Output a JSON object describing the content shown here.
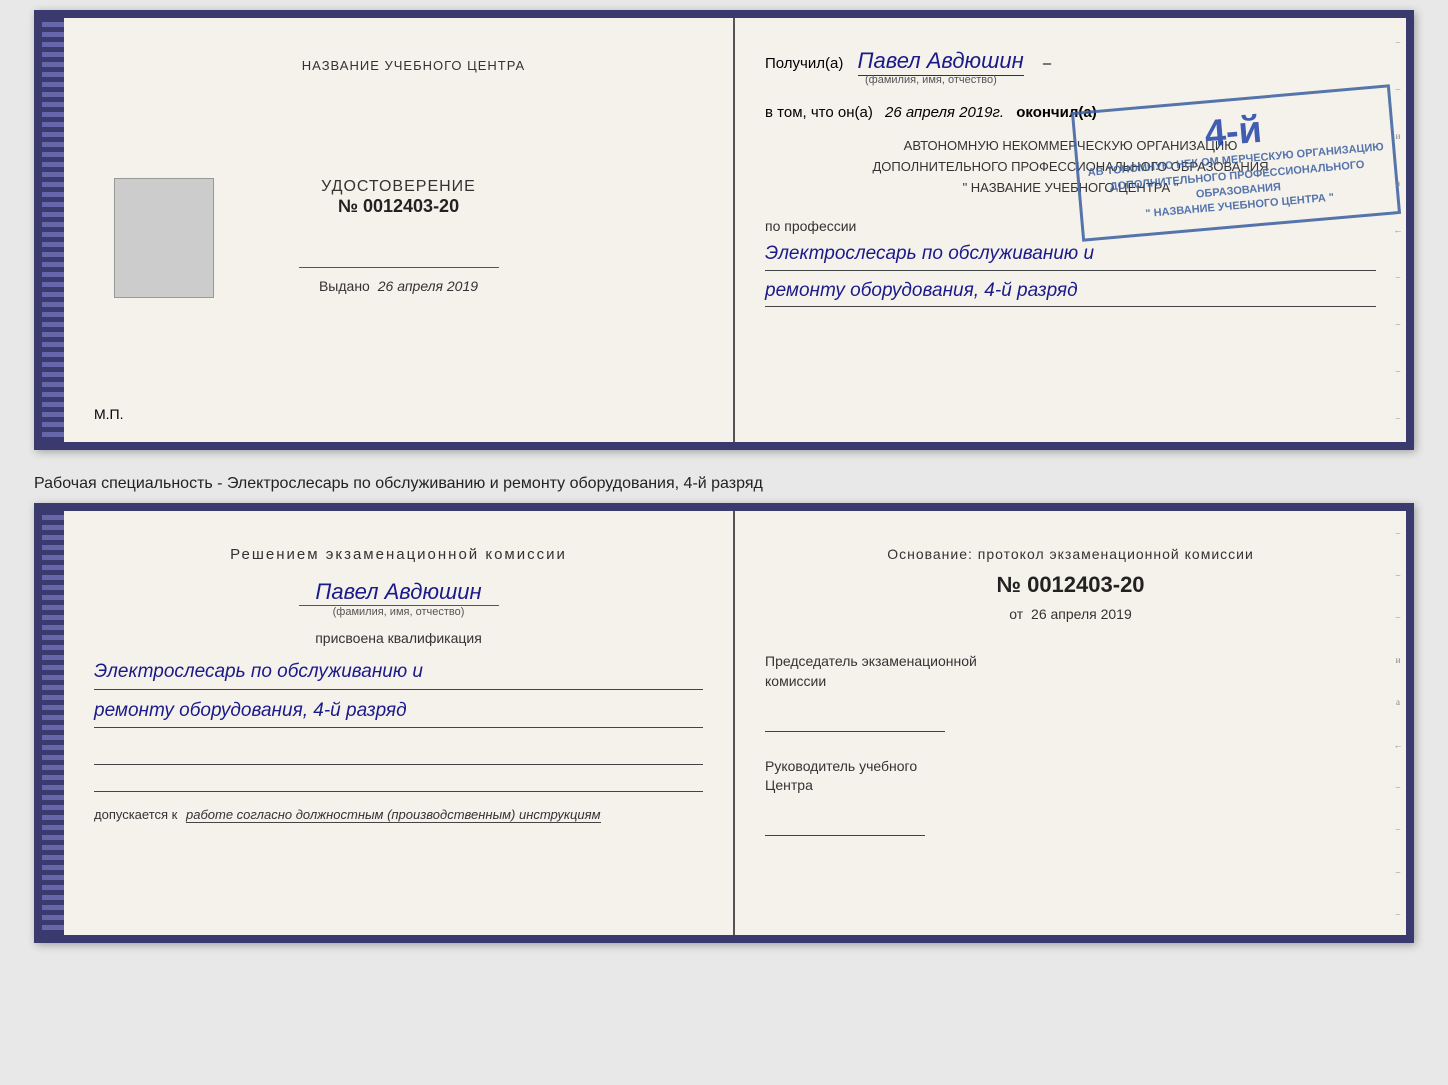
{
  "top_cert": {
    "left": {
      "title": "НАЗВАНИЕ УЧЕБНОГО ЦЕНТРА",
      "photo_alt": "фото",
      "cert_label": "УДОСТОВЕРЕНИЕ",
      "cert_number": "№ 0012403-20",
      "issued_label": "Выдано",
      "issued_date": "26 апреля 2019",
      "mp_label": "М.П."
    },
    "right": {
      "received_label": "Получил(а)",
      "person_name": "Павел Авдюшин",
      "fio_label": "(фамилия, имя, отчество)",
      "vtom_label": "в том, что он(а)",
      "date_value": "26 апреля 2019г.",
      "finished_label": "окончил(а)",
      "org_line1": "АВТОНОМНУЮ НЕКОММЕРЧЕСКУЮ ОРГАНИЗАЦИЮ",
      "org_line2": "ДОПОЛНИТЕЛЬНОГО ПРОФЕССИОНАЛЬНОГО ОБРАЗОВАНИЯ",
      "org_name": "\" НАЗВАНИЕ УЧЕБНОГО ЦЕНТРА \"",
      "profession_label": "по профессии",
      "profession_line1": "Электрослесарь по обслуживанию и",
      "profession_line2": "ремонту оборудования, 4-й разряд",
      "stamp_grade": "4-й",
      "stamp_line1": "АВ ТОНОМНУЮ НЕК ОМ МЕРЧЕСКУЮ ОРГАНИЗАЦИЮ",
      "stamp_line2": "ДОПОЛНИТЕЛЬНОГО ПРОФЕССИОНАЛЬНОГО ОБРАЗОВАНИЯ",
      "stamp_line3": "\" НАЗВАНИЕ УЧЕБНОГО ЦЕНТРА \""
    }
  },
  "between": {
    "text": "Рабочая специальность - Электрослесарь по обслуживанию и ремонту оборудования, 4-й разряд"
  },
  "bottom_cert": {
    "left": {
      "decision_title": "Решением экзаменационной комиссии",
      "person_name": "Павел Авдюшин",
      "fio_label": "(фамилия, имя, отчество)",
      "qualification_label": "присвоена квалификация",
      "qualification_line1": "Электрослесарь по обслуживанию и",
      "qualification_line2": "ремонту оборудования, 4-й разряд",
      "допускается_label": "допускается к",
      "допускается_value": "работе согласно должностным (производственным) инструкциям"
    },
    "right": {
      "osnov_label": "Основание: протокол экзаменационной комиссии",
      "protocol_number": "№ 0012403-20",
      "ot_label": "от",
      "ot_date": "26 апреля 2019",
      "chairman_label1": "Председатель экзаменационной",
      "chairman_label2": "комиссии",
      "director_label1": "Руководитель учебного",
      "director_label2": "Центра"
    }
  }
}
